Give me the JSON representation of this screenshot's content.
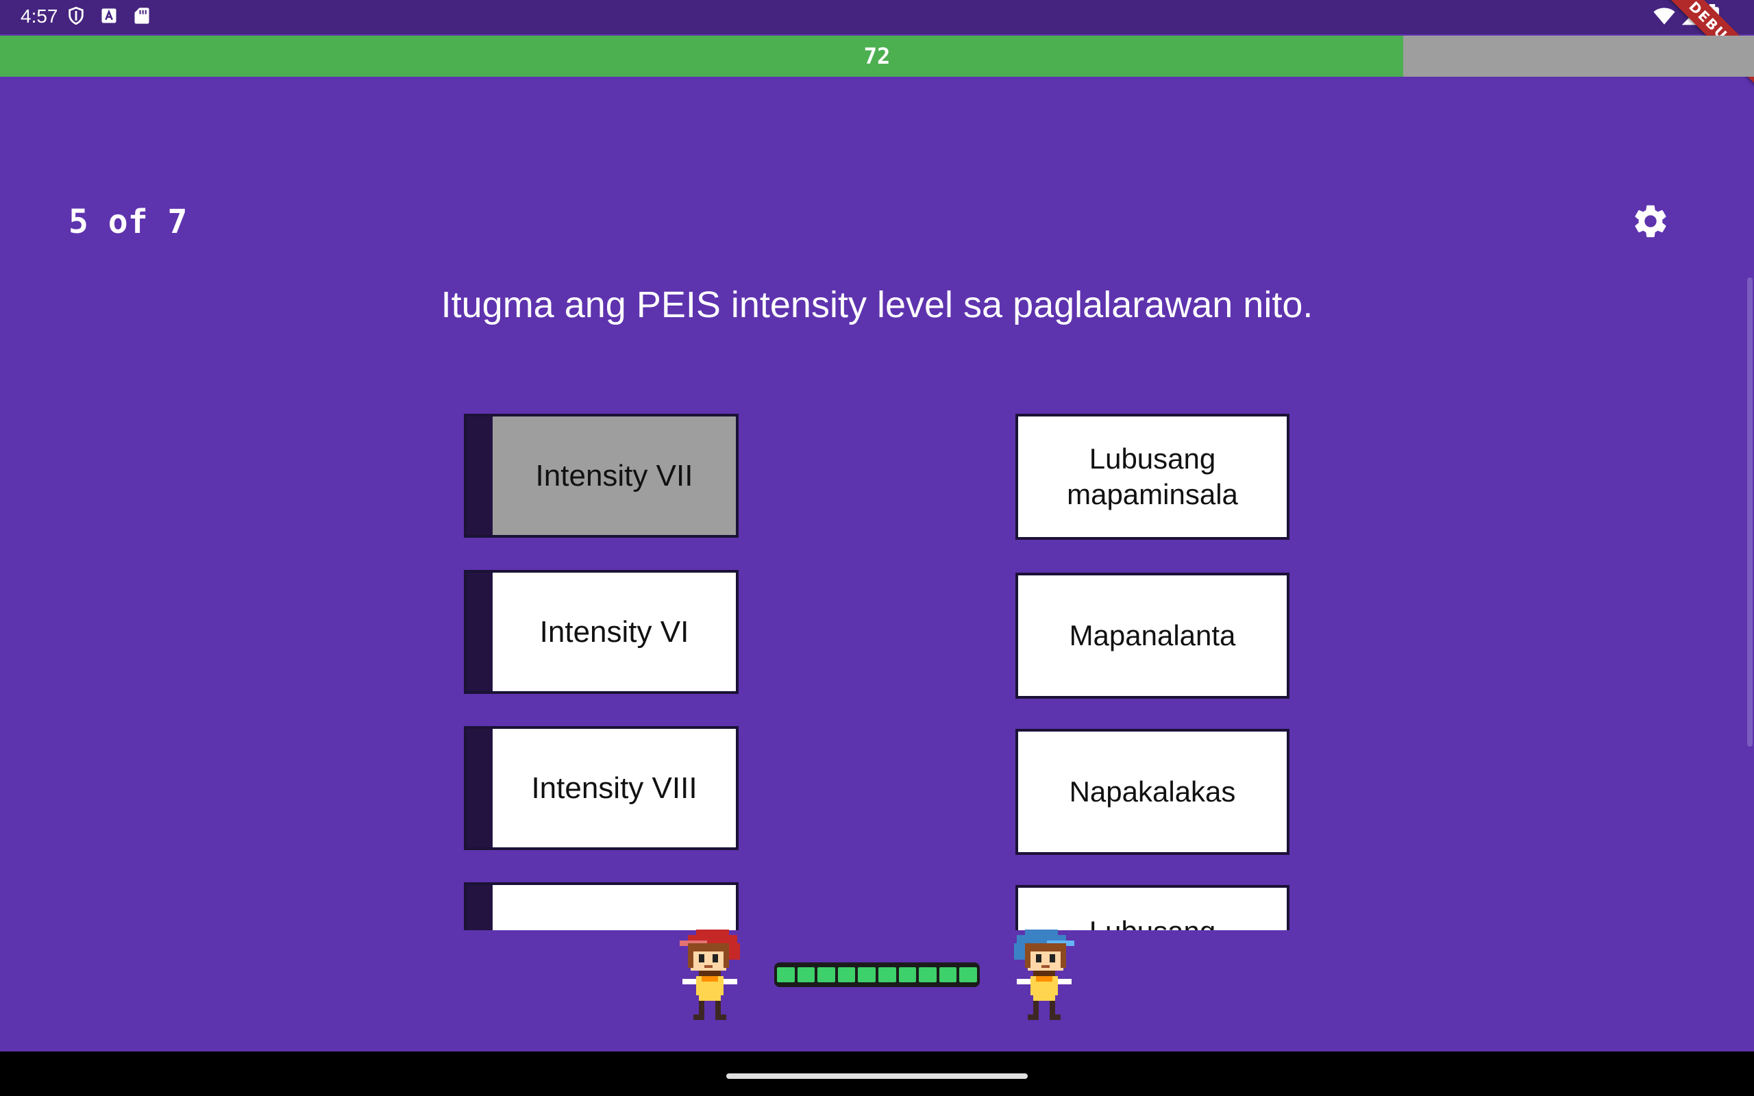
{
  "status_bar": {
    "time": "4:57",
    "left_icons": [
      "shield-icon",
      "a-badge-icon",
      "sd-card-icon"
    ],
    "right_icons": [
      "wifi-icon",
      "signal-icon",
      "battery-icon"
    ],
    "debug_label": "DEBUG"
  },
  "timer": {
    "value": "72",
    "fraction": 0.8,
    "fill_color": "#4caf50",
    "track_color": "#9e9e9e"
  },
  "header": {
    "progress": "5 of 7",
    "settings_icon": "gear-icon"
  },
  "instruction": "Itugma ang PEIS intensity level sa paglalarawan nito.",
  "left_items": [
    {
      "label": "Intensity VII",
      "selected": true
    },
    {
      "label": "Intensity VI",
      "selected": false
    },
    {
      "label": "Intensity VIII",
      "selected": false
    },
    {
      "label": "",
      "selected": false
    }
  ],
  "right_items": [
    {
      "label": "Lubusang mapaminsala"
    },
    {
      "label": "Mapanalanta"
    },
    {
      "label": "Napakalakas"
    },
    {
      "label": "Lubusang"
    }
  ],
  "battle": {
    "player_sprite": "red-cap-character-icon",
    "opponent_sprite": "blue-cap-character-icon",
    "hp_segments": 10,
    "hp_filled": 10,
    "hp_color": "#3ed06a"
  },
  "colors": {
    "background": "#5e33ae",
    "status_bar": "#45247f",
    "card_tab": "#221340",
    "selected_card": "#9e9e9e"
  }
}
